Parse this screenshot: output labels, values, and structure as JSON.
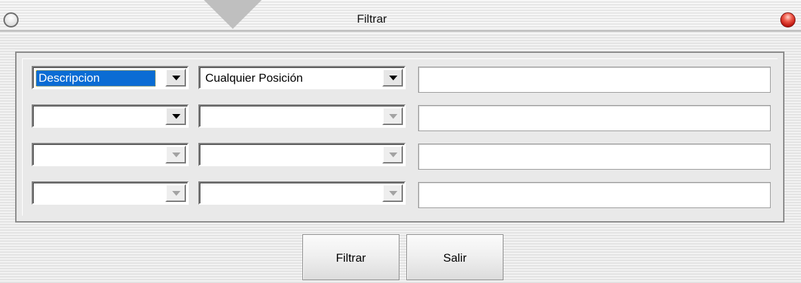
{
  "window": {
    "title": "Filtrar"
  },
  "filters": [
    {
      "field": "Descripcion",
      "field_selected": true,
      "condition": "Cualquier Posición",
      "value": "",
      "field_enabled": true,
      "condition_enabled": true
    },
    {
      "field": "",
      "field_selected": false,
      "condition": "",
      "value": "",
      "field_enabled": true,
      "condition_enabled": false
    },
    {
      "field": "",
      "field_selected": false,
      "condition": "",
      "value": "",
      "field_enabled": false,
      "condition_enabled": false
    },
    {
      "field": "",
      "field_selected": false,
      "condition": "",
      "value": "",
      "field_enabled": false,
      "condition_enabled": false
    }
  ],
  "buttons": {
    "filter_label": "Filtrar",
    "exit_label": "Salir"
  },
  "colors": {
    "selection": "#0a6cd4",
    "close_button": "#c41c14"
  }
}
